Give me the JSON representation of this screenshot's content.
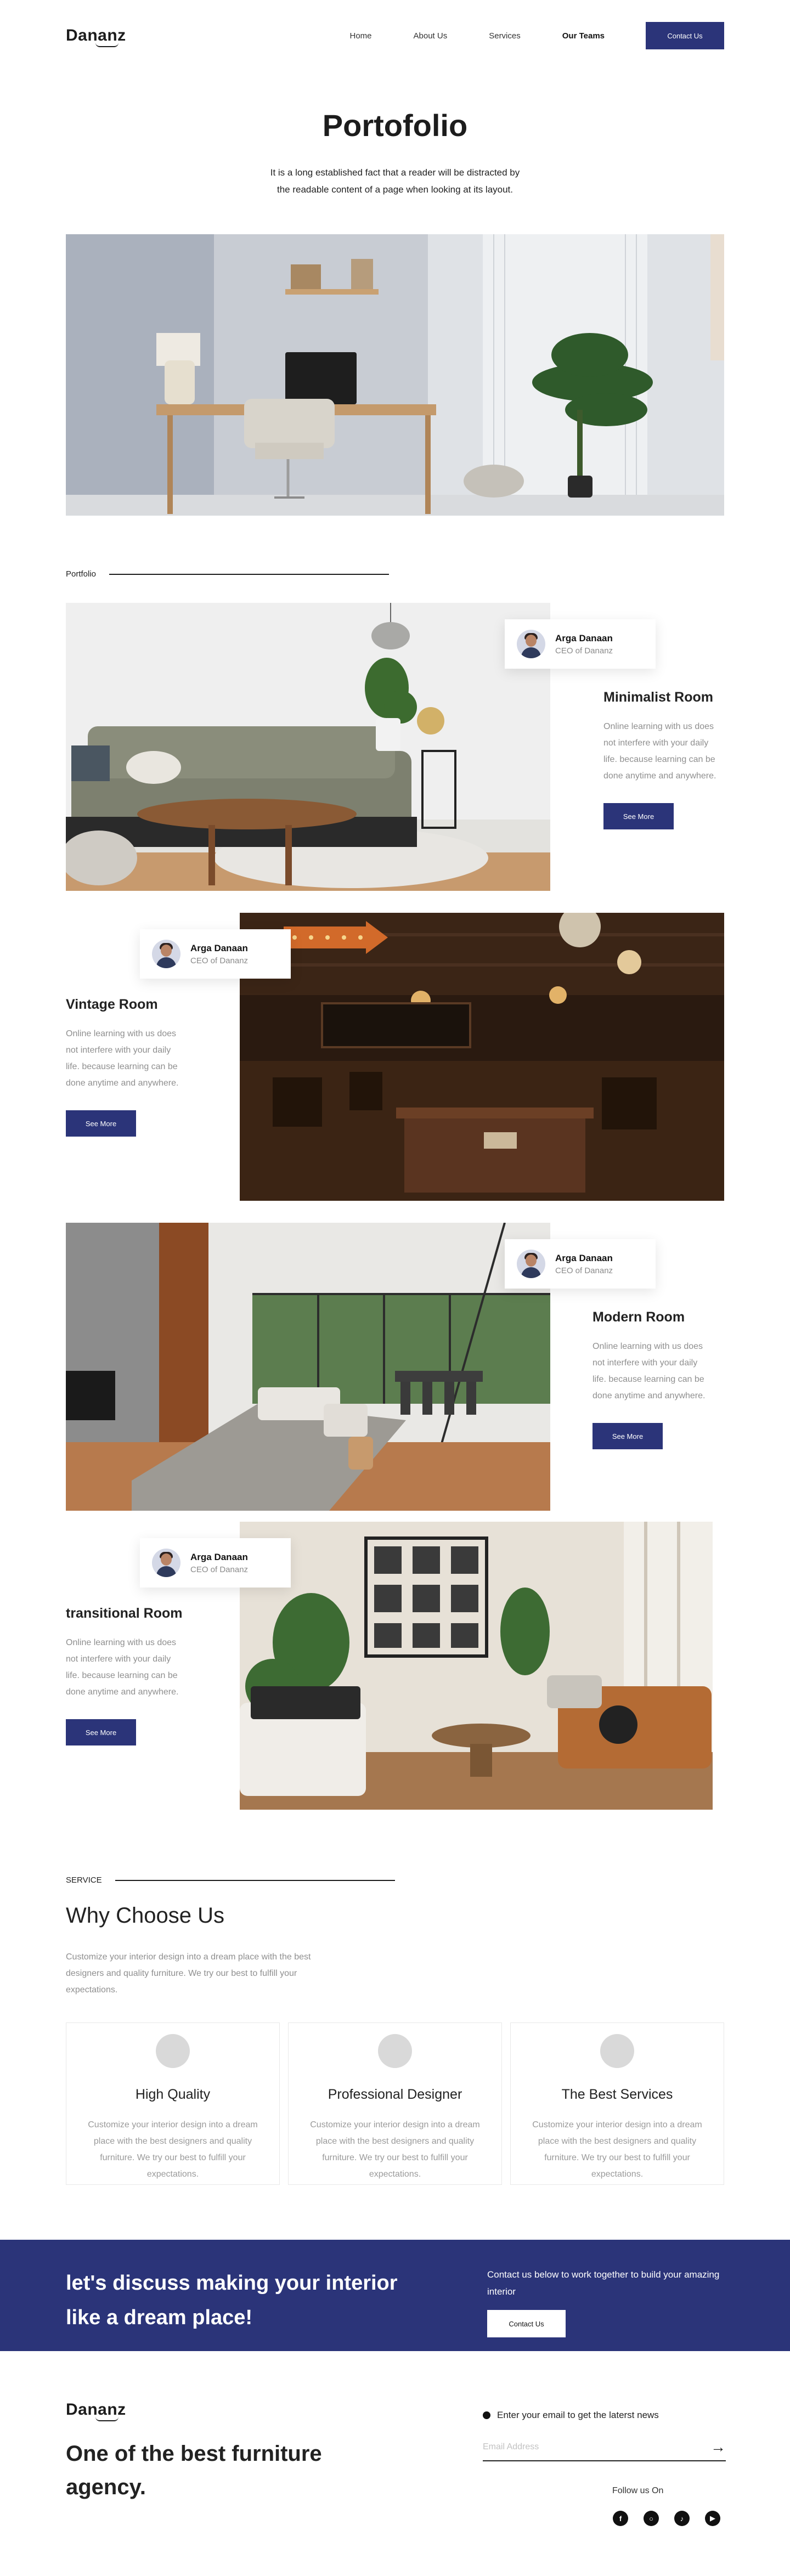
{
  "brand": {
    "logo_text": "Dananz"
  },
  "nav": {
    "links": [
      {
        "label": "Home"
      },
      {
        "label": "About Us"
      },
      {
        "label": "Services"
      },
      {
        "label": "Our Teams"
      }
    ],
    "contact_label": "Contact Us"
  },
  "hero": {
    "title": "Portofolio",
    "description": "It is a long established fact that a reader will be distracted by the readable content of a page when looking at its layout."
  },
  "portfolio": {
    "section_label": "Portfolio",
    "projects": [
      {
        "title": "Minimalist Room",
        "description": "Online learning with us does not interfere with your daily life. because learning can be done anytime and anywhere.",
        "button_label": "See More",
        "author_name": "Arga Danaan",
        "author_role": "CEO of Dananz"
      },
      {
        "title": "Vintage Room",
        "description": "Online learning with us does not interfere with your daily life. because learning can be done anytime and anywhere.",
        "button_label": "See More",
        "author_name": "Arga Danaan",
        "author_role": "CEO of Dananz"
      },
      {
        "title": "Modern Room",
        "description": "Online learning with us does not interfere with your daily life. because learning can be done anytime and anywhere.",
        "button_label": "See More",
        "author_name": "Arga Danaan",
        "author_role": "CEO of Dananz"
      },
      {
        "title": "transitional Room",
        "description": "Online learning with us does not interfere with your daily life. because learning can be done anytime and anywhere.",
        "button_label": "See More",
        "author_name": "Arga Danaan",
        "author_role": "CEO of Dananz"
      }
    ]
  },
  "service": {
    "section_label": "SERVICE",
    "title": "Why Choose Us",
    "description": "Customize your interior design into a dream place with the best designers and quality furniture. We try our best to fulfill your expectations.",
    "cards": [
      {
        "title": "High Quality",
        "description": "Customize your interior design into a dream place with the best designers and quality furniture. We try our best to fulfill your expectations."
      },
      {
        "title": "Professional Designer",
        "description": "Customize your interior design into a dream place with the best designers and quality furniture. We try our best to fulfill your expectations."
      },
      {
        "title": "The Best Services",
        "description": "Customize your interior design into a dream place with the best designers and quality furniture. We try our best to fulfill your expectations."
      }
    ]
  },
  "cta": {
    "title": "let's discuss making your interior like a dream place!",
    "text": "Contact us below to work together to build your amazing interior",
    "button_label": "Contact Us"
  },
  "footer": {
    "logo_text": "Dananz",
    "tagline": "One of the best furniture agency.",
    "newsletter_label": "Enter your email to get the laterst news",
    "email_placeholder": "Email Address",
    "follow_label": "Follow us On",
    "socials": [
      "facebook-icon",
      "instagram-icon",
      "tiktok-icon",
      "youtube-icon"
    ]
  },
  "colors": {
    "primary": "#2b3479",
    "text": "#1c1c1c",
    "muted": "#8f8f8f"
  }
}
